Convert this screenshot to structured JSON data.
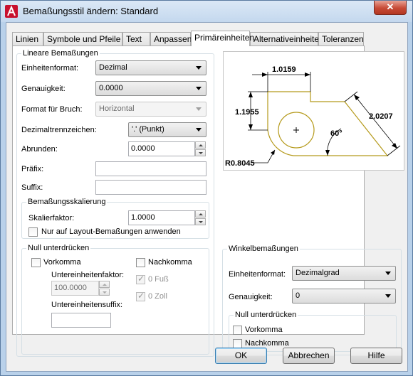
{
  "window": {
    "title": "Bemaßungsstil ändern: Standard",
    "close_glyph": "✕"
  },
  "tabs": [
    {
      "label": "Linien"
    },
    {
      "label": "Symbole und Pfeile"
    },
    {
      "label": "Text"
    },
    {
      "label": "Anpassen"
    },
    {
      "label": "Primäreinheiten",
      "active": true
    },
    {
      "label": "Alternativeinheiten"
    },
    {
      "label": "Toleranzen"
    }
  ],
  "linear": {
    "legend": "Lineare Bemaßungen",
    "unit_format_label": "Einheitenformat:",
    "unit_format_value": "Dezimal",
    "precision_label": "Genauigkeit:",
    "precision_value": "0.0000",
    "fraction_format_label": "Format für Bruch:",
    "fraction_format_value": "Horizontal",
    "decimal_separator_label": "Dezimaltrennzeichen:",
    "decimal_separator_value": "'.' (Punkt)",
    "round_off_label": "Abrunden:",
    "round_off_value": "0.0000",
    "prefix_label": "Präfix:",
    "prefix_value": "",
    "suffix_label": "Suffix:",
    "suffix_value": ""
  },
  "scale": {
    "legend": "Bemaßungsskalierung",
    "factor_label": "Skalierfaktor:",
    "factor_value": "1.0000",
    "layout_only_label": "Nur auf Layout-Bemaßungen anwenden",
    "layout_only_checked": false
  },
  "zero_linear": {
    "legend": "Null unterdrücken",
    "leading_label": "Vorkomma",
    "subunit_factor_label": "Untereinheitenfaktor:",
    "subunit_factor_value": "100.0000",
    "subunit_suffix_label": "Untereinheitensuffix:",
    "subunit_suffix_value": "",
    "trailing_label": "Nachkomma",
    "feet_label": "0 Fuß",
    "inches_label": "0 Zoll"
  },
  "preview": {
    "dim_top": "1.0159",
    "dim_left": "1.1955",
    "dim_right": "2.0207",
    "angle": "60°",
    "radius": "R0.8045"
  },
  "angular": {
    "legend": "Winkelbemaßungen",
    "unit_format_label": "Einheitenformat:",
    "unit_format_value": "Dezimalgrad",
    "precision_label": "Genauigkeit:",
    "precision_value": "0"
  },
  "zero_angular": {
    "legend": "Null unterdrücken",
    "leading_label": "Vorkomma",
    "trailing_label": "Nachkomma"
  },
  "buttons": {
    "ok": "OK",
    "cancel": "Abbrechen",
    "help": "Hilfe"
  },
  "colors": {
    "accent": "#3c7fb1",
    "preview_geometry": "#b59a1c",
    "close": "#c74a36"
  }
}
